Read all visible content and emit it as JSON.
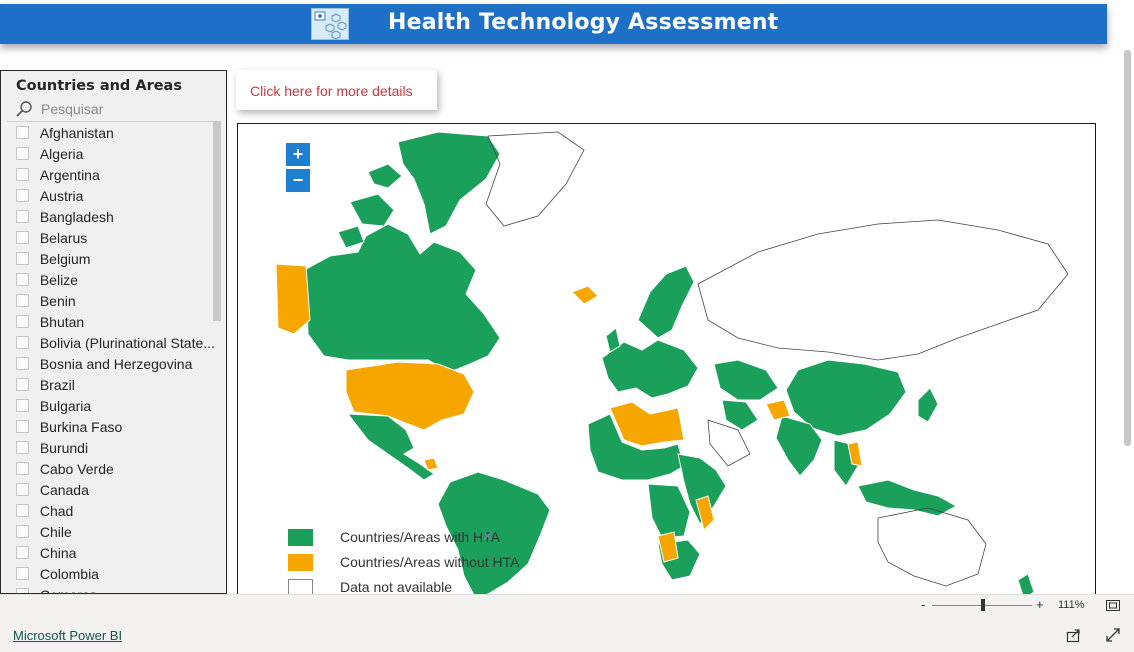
{
  "header": {
    "title": "Health Technology Assessment"
  },
  "slicer": {
    "title": "Countries and Areas",
    "search_placeholder": "Pesquisar",
    "items": [
      "Afghanistan",
      "Algeria",
      "Argentina",
      "Austria",
      "Bangladesh",
      "Belarus",
      "Belgium",
      "Belize",
      "Benin",
      "Bhutan",
      "Bolivia (Plurinational State...",
      "Bosnia and Herzegovina",
      "Brazil",
      "Bulgaria",
      "Burkina Faso",
      "Burundi",
      "Cabo Verde",
      "Canada",
      "Chad",
      "Chile",
      "China",
      "Colombia",
      "Comoros"
    ]
  },
  "details_button": {
    "label": "Click here for more details"
  },
  "map": {
    "zoom_in_label": "+",
    "zoom_out_label": "−",
    "legend": [
      {
        "label": "Countries/Areas with HTA",
        "color": "#1aa05a"
      },
      {
        "label": "Countries/Areas without HTA",
        "color": "#f7a600"
      },
      {
        "label": "Data not available",
        "color": "#ffffff"
      }
    ],
    "legend_close": "✕"
  },
  "statusbar": {
    "zoom_minus": "-",
    "zoom_plus": "+",
    "zoom_level": "111%"
  },
  "footer": {
    "powerbi_link": "Microsoft Power BI"
  },
  "colors": {
    "header_blue": "#1e6fc6",
    "hta_green": "#1aa05a",
    "no_hta_orange": "#f7a600",
    "link_red": "#c8383f"
  },
  "icons": [
    "search-icon",
    "share-icon",
    "expand-icon",
    "fit-to-page-icon",
    "close-icon"
  ]
}
